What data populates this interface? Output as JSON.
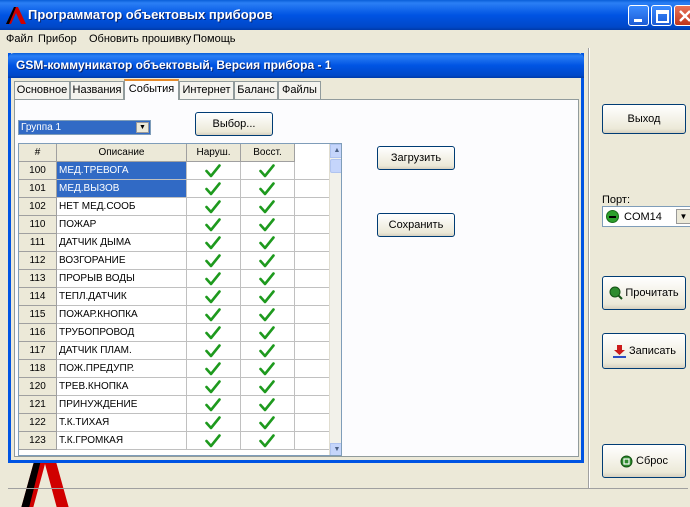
{
  "app": {
    "title": "Программатор объектовых приборов",
    "logo_icon": "brand-logo-icon",
    "caption_buttons": [
      "minimize-icon",
      "maximize-icon",
      "close-icon"
    ]
  },
  "menu": {
    "items": [
      "Файл",
      "Прибор",
      "Обновить прошивку",
      "Помощь"
    ]
  },
  "dialog": {
    "title": "GSM-коммуникатор объектовый, Версия прибора - 1",
    "tabs": [
      "Основное",
      "Названия",
      "События",
      "Интернет",
      "Баланс",
      "Файлы"
    ],
    "active_tab": "События",
    "group_select": {
      "value": "Группа 1"
    },
    "select_button": "Выбор...",
    "load_button": "Загрузить",
    "save_button": "Сохранить",
    "grid": {
      "columns": [
        "#",
        "Описание",
        "Наруш.",
        "Восст."
      ],
      "rows": [
        {
          "num": "100",
          "desc": "МЕД.ТРЕВОГА",
          "violation": true,
          "restore": true,
          "selected": true
        },
        {
          "num": "101",
          "desc": "МЕД.ВЫЗОВ",
          "violation": true,
          "restore": true,
          "selected": true
        },
        {
          "num": "102",
          "desc": "НЕТ МЕД.СООБ",
          "violation": true,
          "restore": true,
          "selected": false
        },
        {
          "num": "110",
          "desc": "ПОЖАР",
          "violation": true,
          "restore": true,
          "selected": false
        },
        {
          "num": "111",
          "desc": "ДАТЧИК ДЫМА",
          "violation": true,
          "restore": true,
          "selected": false
        },
        {
          "num": "112",
          "desc": "ВОЗГОРАНИЕ",
          "violation": true,
          "restore": true,
          "selected": false
        },
        {
          "num": "113",
          "desc": "ПРОРЫВ ВОДЫ",
          "violation": true,
          "restore": true,
          "selected": false
        },
        {
          "num": "114",
          "desc": "ТЕПЛ.ДАТЧИК",
          "violation": true,
          "restore": true,
          "selected": false
        },
        {
          "num": "115",
          "desc": "ПОЖАР.КНОПКА",
          "violation": true,
          "restore": true,
          "selected": false
        },
        {
          "num": "116",
          "desc": "ТРУБОПРОВОД",
          "violation": true,
          "restore": true,
          "selected": false
        },
        {
          "num": "117",
          "desc": "ДАТЧИК ПЛАМ.",
          "violation": true,
          "restore": true,
          "selected": false
        },
        {
          "num": "118",
          "desc": "ПОЖ.ПРЕДУПР.",
          "violation": true,
          "restore": true,
          "selected": false
        },
        {
          "num": "120",
          "desc": "ТРЕВ.КНОПКА",
          "violation": true,
          "restore": true,
          "selected": false
        },
        {
          "num": "121",
          "desc": "ПРИНУЖДЕНИЕ",
          "violation": true,
          "restore": true,
          "selected": false
        },
        {
          "num": "122",
          "desc": "Т.К.ТИХАЯ",
          "violation": true,
          "restore": true,
          "selected": false
        },
        {
          "num": "123",
          "desc": "Т.К.ГРОМКАЯ",
          "violation": true,
          "restore": true,
          "selected": false
        }
      ]
    }
  },
  "side": {
    "exit_button": "Выход",
    "port_label": "Порт:",
    "port_value": "COM14",
    "read_button": "Прочитать",
    "write_button": "Записать",
    "reset_button": "Сброс"
  },
  "colors": {
    "titlebar": "#0054e3",
    "selection": "#316ac5",
    "check": "#1e9a1e",
    "port_status": "#2ca02c"
  }
}
